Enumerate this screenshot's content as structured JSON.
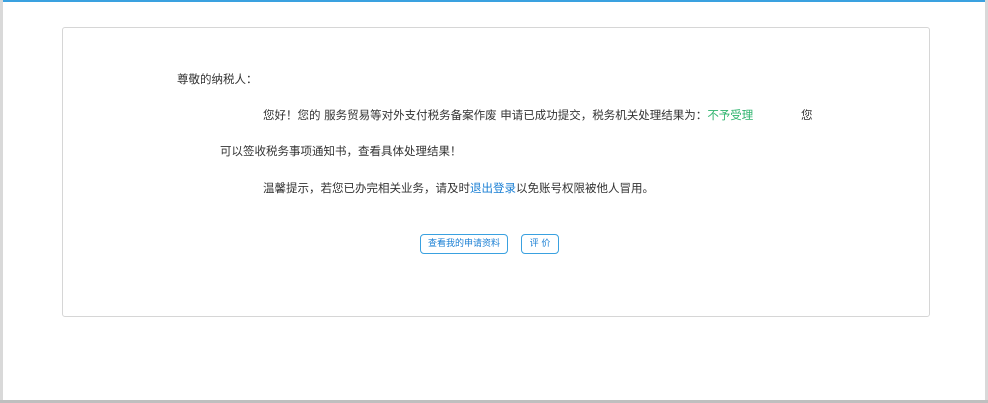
{
  "notice": {
    "greeting": "尊敬的纳税人：",
    "line1_prefix": "您好！您的 服务贸易等对外支付税务备案作废 申请已成功提交，税务机关处理结果为：",
    "line1_result": "不予受理",
    "line1_tail": "您",
    "line2": "可以签收税务事项通知书，查看具体处理结果！",
    "line3_prefix": "温馨提示，若您已办完相关业务，请及时",
    "line3_link": "退出登录",
    "line3_suffix": "以免账号权限被他人冒用。"
  },
  "buttons": {
    "view_application": "查看我的申请资料",
    "rate": "评 价"
  },
  "colors": {
    "accent": "#3aa1e0",
    "link": "#1a7fd4",
    "result": "#2fb46e",
    "text": "#333333"
  }
}
